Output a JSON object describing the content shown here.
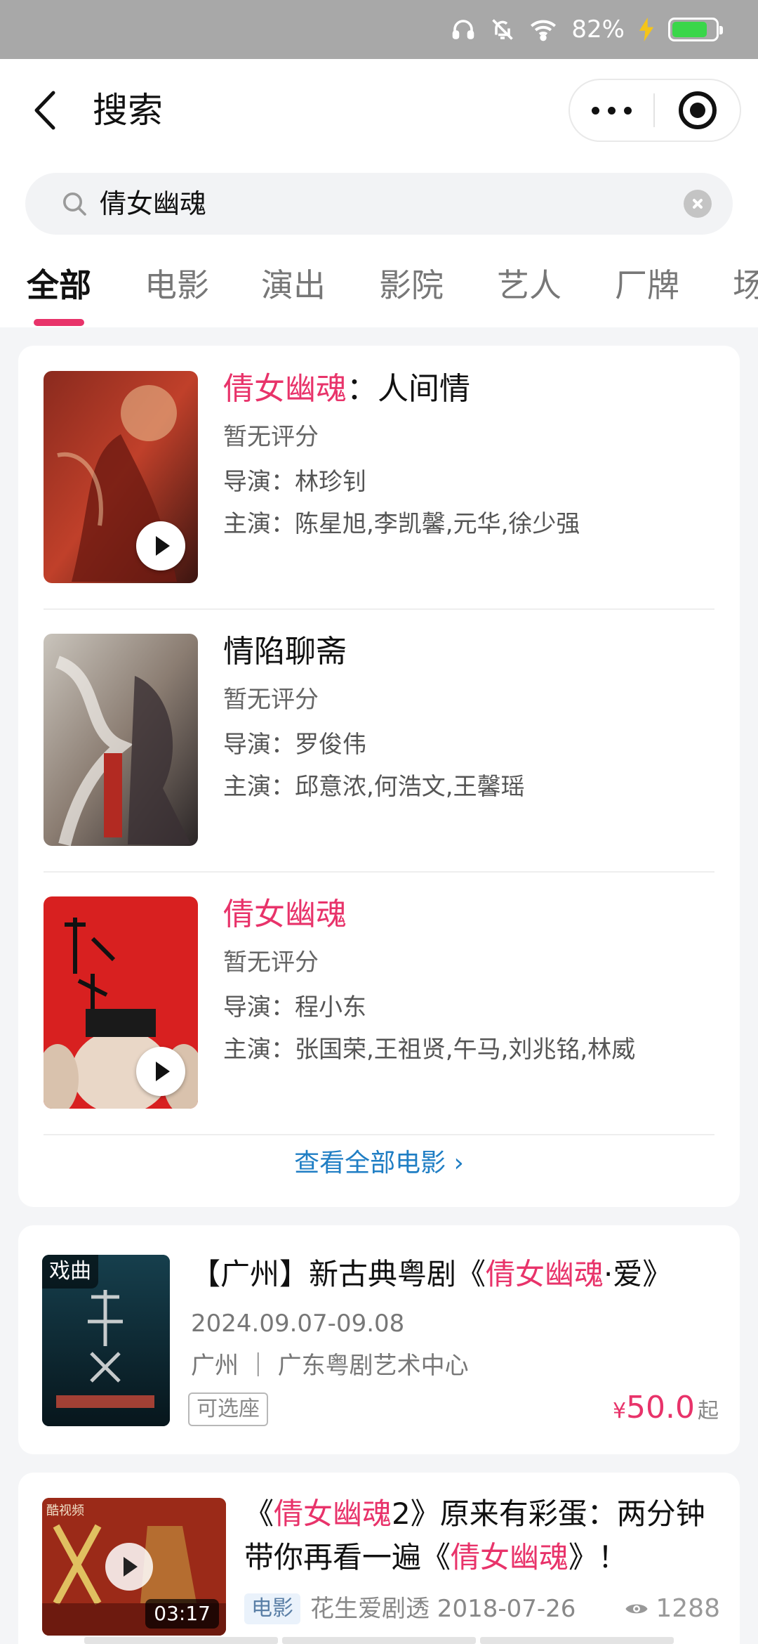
{
  "status_bar": {
    "battery_pct": "82%",
    "battery_level": 0.82
  },
  "header": {
    "title": "搜索"
  },
  "search": {
    "query": "倩女幽魂"
  },
  "tabs": [
    {
      "label": "全部",
      "active": true
    },
    {
      "label": "电影",
      "active": false
    },
    {
      "label": "演出",
      "active": false
    },
    {
      "label": "影院",
      "active": false
    },
    {
      "label": "艺人",
      "active": false
    },
    {
      "label": "厂牌",
      "active": false
    },
    {
      "label": "场",
      "active": false
    }
  ],
  "movies": [
    {
      "title_highlight": "倩女幽魂",
      "title_rest": "：人间情",
      "rating": "暂无评分",
      "director": "导演：林珍钊",
      "actors": "主演：陈星旭,李凯馨,元华,徐少强",
      "has_play": true
    },
    {
      "title_highlight": "",
      "title_rest": "情陷聊斋",
      "rating": "暂无评分",
      "director": "导演：罗俊伟",
      "actors": "主演：邱意浓,何浩文,王馨瑶",
      "has_play": false
    },
    {
      "title_highlight": "倩女幽魂",
      "title_rest": "",
      "rating": "暂无评分",
      "director": "导演：程小东",
      "actors": "主演：张国荣,王祖贤,午马,刘兆铭,林威",
      "has_play": true
    }
  ],
  "see_all": "查看全部电影 ›",
  "show": {
    "tag": "戏曲",
    "title_prefix": "【广州】新古典粤剧《",
    "title_highlight": "倩女幽魂",
    "title_suffix": "·爱》",
    "date": "2024.09.07-09.08",
    "venue": "广州 ｜ 广东粤剧艺术中心",
    "badge": "可选座",
    "price_currency": "¥",
    "price": "50.0",
    "price_suffix": "起"
  },
  "video": {
    "title_parts": [
      {
        "text": "《",
        "hl": false
      },
      {
        "text": "倩女幽魂",
        "hl": true
      },
      {
        "text": "2》原来有彩蛋：两分钟带你再看一遍《",
        "hl": false
      },
      {
        "text": "倩女幽魂",
        "hl": true
      },
      {
        "text": "》！",
        "hl": false
      }
    ],
    "duration": "03:17",
    "category": "电影",
    "author_date": "花生爱剧透 2018-07-26",
    "views": "1288",
    "thumb_source": "酷视频"
  },
  "colors": {
    "accent": "#e8336a",
    "link": "#1f7ec4"
  }
}
